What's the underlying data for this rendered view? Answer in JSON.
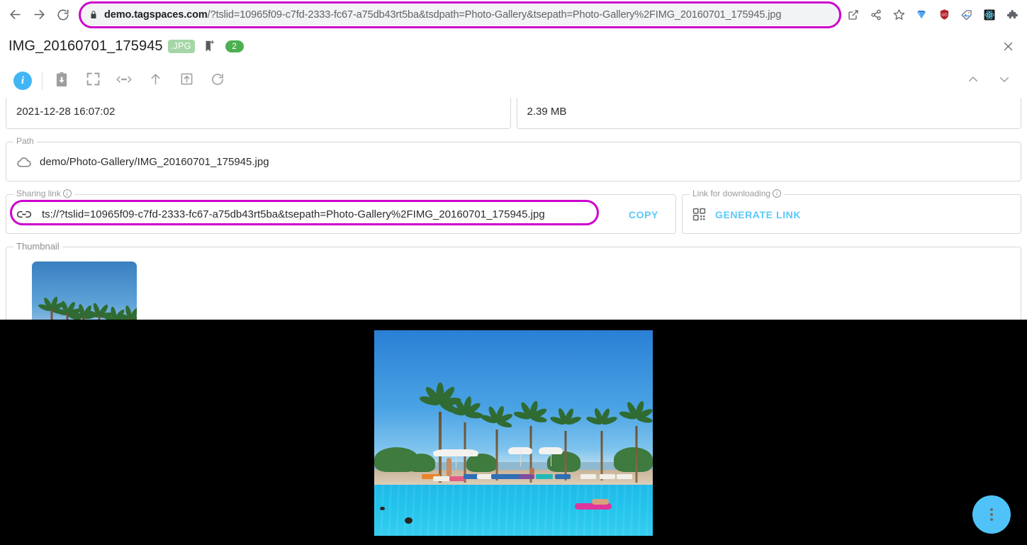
{
  "browser": {
    "back_icon": "back-arrow-icon",
    "forward_icon": "forward-arrow-icon",
    "reload_icon": "reload-icon",
    "lock_icon": "lock-icon",
    "url_domain": "demo.tagspaces.com",
    "url_rest": "/?tslid=10965f09-c7fd-2333-fc67-a75db43rt5ba&tsdpath=Photo-Gallery&tsepath=Photo-Gallery%2FIMG_20160701_175945.jpg",
    "url_full": "demo.tagspaces.com/?tslid=10965f09-c7fd-2333-fc67-a75db43rt5ba&tsdpath=Photo-Gallery&tsepath=Photo-Gallery%2FIMG_20160701_175945.jpg",
    "highlight_color": "#cc00cc",
    "icons": [
      {
        "name": "open-in-new-icon"
      },
      {
        "name": "share-icon"
      },
      {
        "name": "bookmark-star-icon"
      },
      {
        "name": "gem-extension-icon"
      },
      {
        "name": "shield-blocker-extension-icon"
      },
      {
        "name": "tag-extension-icon"
      },
      {
        "name": "react-devtools-extension-icon"
      },
      {
        "name": "puzzle-extensions-icon"
      },
      {
        "name": "side-panel-icon"
      },
      {
        "name": "profile-avatar-icon"
      },
      {
        "name": "chrome-menu-icon"
      }
    ]
  },
  "header": {
    "file_name": "IMG_20160701_175945",
    "file_extension": ".JPG",
    "extension_badge_color": "#a5d6a7",
    "bookmark_icon": "add-bookmark-icon",
    "tag_count": "2",
    "tag_chip_color": "#4caf50",
    "close_label": "close-icon"
  },
  "toolbar": {
    "buttons": [
      {
        "name": "file-properties-info-button",
        "icon": "info-circle-icon",
        "label": "i",
        "active": true
      },
      {
        "name": "save-file-button",
        "icon": "save-clipboard-icon"
      },
      {
        "name": "fullscreen-button",
        "icon": "expand-fullscreen-icon"
      },
      {
        "name": "open-properties-button",
        "icon": "code-angle-brackets-icon"
      },
      {
        "name": "open-parent-folder-button",
        "icon": "arrow-up-icon"
      },
      {
        "name": "open-natively-button",
        "icon": "open-external-box-icon"
      },
      {
        "name": "reload-file-button",
        "icon": "reload-circular-arrow-icon"
      }
    ],
    "nav_up_icon": "chevron-up-icon",
    "nav_down_icon": "chevron-down-icon"
  },
  "fields": {
    "modified_date": {
      "value": "2021-12-28 16:07:02"
    },
    "size": {
      "value": "2.39 MB"
    },
    "path": {
      "legend": "Path",
      "icon": "cloud-icon",
      "value": "demo/Photo-Gallery/IMG_20160701_175945.jpg"
    },
    "sharing_link": {
      "legend": "Sharing link",
      "info_icon": "info-outline-icon",
      "icon": "link-chain-icon",
      "value": "ts://?tslid=10965f09-c7fd-2333-fc67-a75db43rt5ba&tsepath=Photo-Gallery%2FIMG_20160701_175945.jpg",
      "copy_label": "COPY",
      "copy_color": "#5ac8fa",
      "highlight_color": "#cc00cc"
    },
    "download_link": {
      "legend": "Link for downloading",
      "info_icon": "info-outline-icon",
      "icon": "qr-code-icon",
      "generate_label": "GENERATE LINK",
      "generate_color": "#5ac8fa"
    },
    "thumbnail": {
      "legend": "Thumbnail",
      "alt": "pool-with-palm-trees-thumbnail"
    }
  },
  "viewer": {
    "background_color": "#000000",
    "photo_alt": "swimming-pool-with-palm-trees-and-sun-loungers",
    "fab": {
      "name": "more-options-fab",
      "icon": "three-dots-vertical-icon",
      "color": "#4fc3f7"
    }
  }
}
